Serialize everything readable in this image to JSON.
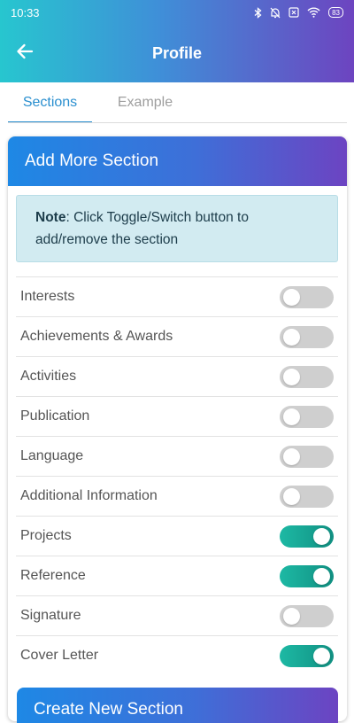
{
  "status_bar": {
    "time": "10:33",
    "battery": "83",
    "icons": [
      "bluetooth-icon",
      "mute-icon",
      "sim-icon",
      "wifi-icon",
      "battery-icon"
    ]
  },
  "appbar": {
    "title": "Profile",
    "back_icon": "arrow-left-icon"
  },
  "tabs": [
    {
      "label": "Sections",
      "active": true
    },
    {
      "label": "Example",
      "active": false
    }
  ],
  "card": {
    "title": "Add More Section",
    "note_bold": "Note",
    "note_text": ": Click Toggle/Switch button to add/remove the section"
  },
  "sections": [
    {
      "label": "Interests",
      "on": false
    },
    {
      "label": "Achievements & Awards",
      "on": false
    },
    {
      "label": "Activities",
      "on": false
    },
    {
      "label": "Publication",
      "on": false
    },
    {
      "label": "Language",
      "on": false
    },
    {
      "label": "Additional Information",
      "on": false
    },
    {
      "label": "Projects",
      "on": true
    },
    {
      "label": "Reference",
      "on": true
    },
    {
      "label": "Signature",
      "on": false
    },
    {
      "label": "Cover Letter",
      "on": true
    }
  ],
  "next_card": {
    "title": "Create New Section"
  },
  "colors": {
    "accent": "#2a8fcf",
    "toggle_on": "#16a596",
    "toggle_off": "#cfcfcf"
  }
}
